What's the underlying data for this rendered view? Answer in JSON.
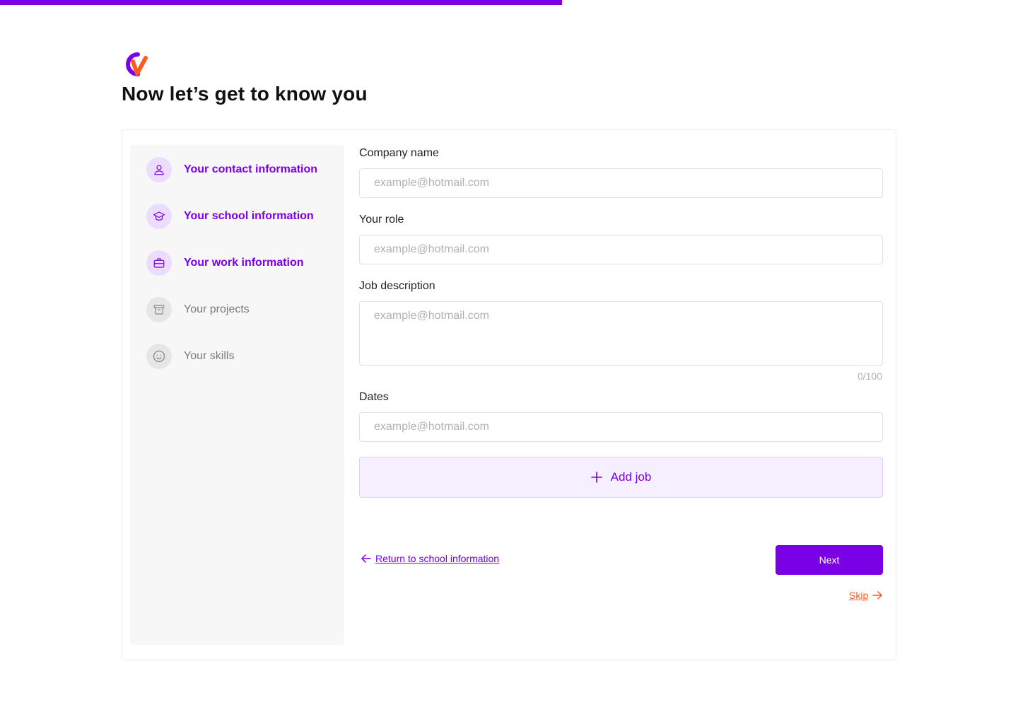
{
  "progress": {
    "fraction": 0.552
  },
  "brand": {
    "logo_icon": "cv-logo-icon",
    "colors": {
      "primary": "#7a00e6",
      "secondary": "#ff5a1f"
    }
  },
  "header": {
    "title": "Now let’s get to know you"
  },
  "sidebar": {
    "steps": [
      {
        "label": "Your contact information",
        "icon": "user-icon",
        "state": "active"
      },
      {
        "label": "Your school information",
        "icon": "graduation-cap-icon",
        "state": "active"
      },
      {
        "label": "Your work information",
        "icon": "briefcase-icon",
        "state": "active"
      },
      {
        "label": "Your projects",
        "icon": "archive-box-icon",
        "state": "inactive"
      },
      {
        "label": "Your skills",
        "icon": "smiley-icon",
        "state": "inactive"
      }
    ]
  },
  "form": {
    "company_name": {
      "label": "Company name",
      "placeholder": "example@hotmail.com",
      "value": ""
    },
    "role": {
      "label": "Your role",
      "placeholder": "example@hotmail.com",
      "value": ""
    },
    "job_description": {
      "label": "Job description",
      "placeholder": "example@hotmail.com",
      "value": "",
      "char_count": "0/100"
    },
    "dates": {
      "label": "Dates",
      "placeholder": "example@hotmail.com",
      "value": ""
    },
    "add_job_label": "Add job"
  },
  "navigation": {
    "back_label": "Return to school information",
    "next_label": "Next",
    "skip_label": "Skip"
  }
}
